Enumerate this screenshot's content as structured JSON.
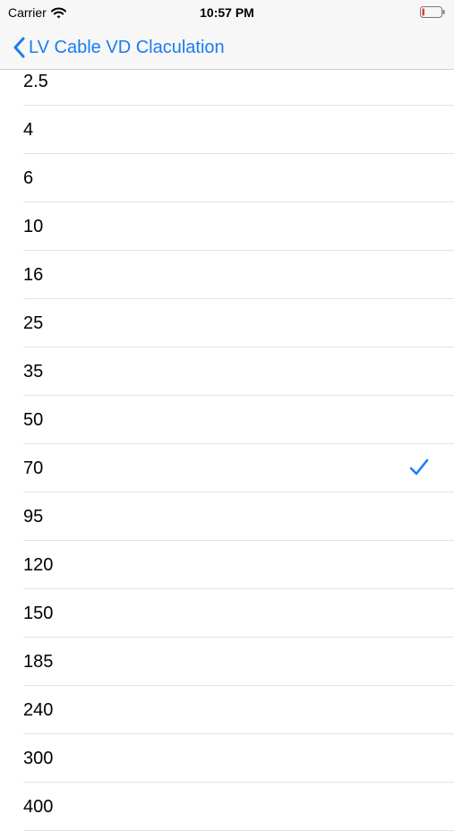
{
  "status_bar": {
    "carrier": "Carrier",
    "time": "10:57 PM"
  },
  "nav": {
    "back_label": "LV Cable VD Claculation"
  },
  "options": [
    {
      "label": "2.5",
      "selected": false
    },
    {
      "label": "4",
      "selected": false
    },
    {
      "label": "6",
      "selected": false
    },
    {
      "label": "10",
      "selected": false
    },
    {
      "label": "16",
      "selected": false
    },
    {
      "label": "25",
      "selected": false
    },
    {
      "label": "35",
      "selected": false
    },
    {
      "label": "50",
      "selected": false
    },
    {
      "label": "70",
      "selected": true
    },
    {
      "label": "95",
      "selected": false
    },
    {
      "label": "120",
      "selected": false
    },
    {
      "label": "150",
      "selected": false
    },
    {
      "label": "185",
      "selected": false
    },
    {
      "label": "240",
      "selected": false
    },
    {
      "label": "300",
      "selected": false
    },
    {
      "label": "400",
      "selected": false
    }
  ],
  "colors": {
    "accent": "#1a7cf0",
    "bar_background": "#f7f7f7",
    "separator": "#e2e2e6"
  },
  "icons": {
    "wifi": "wifi-icon",
    "battery": "battery-icon",
    "back": "chevron-left-icon",
    "selected": "checkmark-icon"
  }
}
